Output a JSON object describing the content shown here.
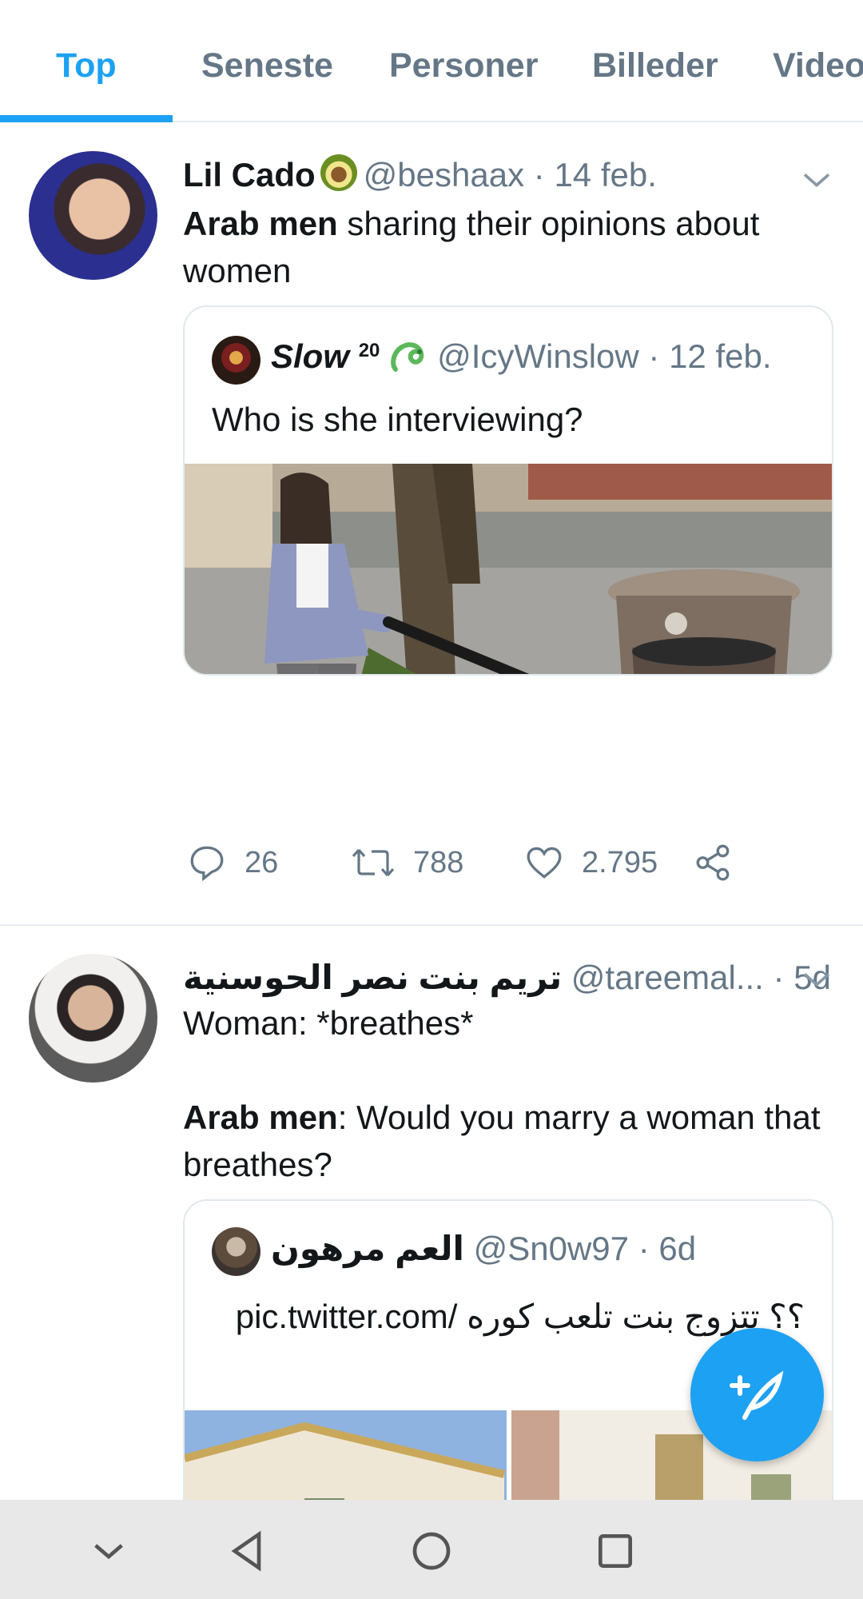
{
  "tabs": [
    {
      "label": "Top",
      "active": true
    },
    {
      "label": "Seneste",
      "active": false
    },
    {
      "label": "Personer",
      "active": false
    },
    {
      "label": "Billeder",
      "active": false
    },
    {
      "label": "Video",
      "active": false
    }
  ],
  "accent_color": "#1da1f2",
  "tweets": [
    {
      "name": "Lil Cado",
      "emoji": "avocado",
      "handle": "@beshaax",
      "sep": "·",
      "date": "14 feb.",
      "text_bold": "Arab men",
      "text_rest": " sharing their opinions about women",
      "quote": {
        "name": "Slow",
        "name_sup": "20",
        "emoji": "snake",
        "handle": "@IcyWinslow",
        "sep": "·",
        "date": "12 feb.",
        "text": "Who is she interviewing?"
      },
      "replies": "26",
      "retweets": "788",
      "likes": "2.795"
    },
    {
      "name": "تريم بنت نصر الحوسنية",
      "handle": "@tareemal...",
      "sep": "·",
      "date": "5d",
      "text_line1": "Woman: *breathes*",
      "text_bold": "Arab men",
      "text_rest": ": Would you marry a woman that breathes?",
      "quote": {
        "name": "العم مرهون",
        "handle": "@Sn0w97",
        "sep": "·",
        "date": "6d",
        "text": "pic.twitter.com/ ؟؟ تتزوج بنت تلعب كوره KtdnQ"
      }
    }
  ],
  "icons": {
    "chevron": "chevron-down-icon",
    "reply": "reply-icon",
    "retweet": "retweet-icon",
    "like": "heart-icon",
    "share": "share-icon",
    "compose": "compose-tweet-icon"
  }
}
